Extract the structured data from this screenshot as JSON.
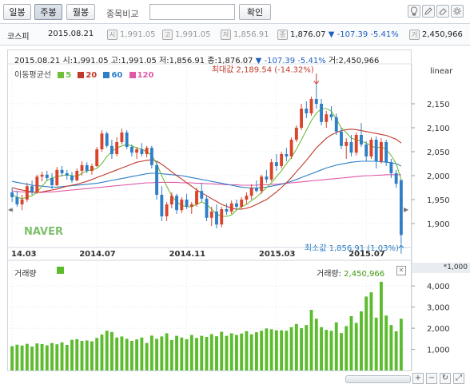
{
  "toolbar": {
    "period_buttons": [
      "일봉",
      "주봉",
      "월봉"
    ],
    "active_period": "주봉",
    "compare_label": "종목비교",
    "compare_placeholder": "",
    "confirm_label": "확인"
  },
  "summary": {
    "name": "코스피",
    "date": "2015.08.21",
    "open_badge": "시",
    "open": "1,991.05",
    "high_badge": "고",
    "high": "1,991.05",
    "low_badge": "저",
    "low": "1,856.91",
    "close_badge": "종",
    "close": "1,876.07",
    "change": "-107.39",
    "change_pct": "-5.41%",
    "volume_badge": "거",
    "volume": "2,450,966"
  },
  "info": {
    "date": "2015.08.21",
    "open_label": "시:",
    "open": "1,991.05",
    "high_label": "고:",
    "high": "1,991.05",
    "low_label": "저:",
    "low": "1,856.91",
    "close_label": "종:",
    "close": "1,876.07",
    "change": "-107.39",
    "change_pct": "-5.41%",
    "volume_label": "거:",
    "volume": "2,450,966"
  },
  "moving_avg": {
    "label": "이동평균선",
    "items": [
      {
        "period": "5",
        "color": "#6fbf3a"
      },
      {
        "period": "20",
        "color": "#c0392b"
      },
      {
        "period": "60",
        "color": "#2f7fc8"
      },
      {
        "period": "120",
        "color": "#e05aa8"
      }
    ]
  },
  "scale_label": "linear",
  "watermark": "NAVER",
  "volume_panel": {
    "label": "거래량",
    "value_label": "거래량:",
    "value": "2,450,966",
    "unit_label": "*1,000",
    "bar_color": "#5dbb2e"
  },
  "colors": {
    "up": "#d9442b",
    "down": "#2f7fc8",
    "ma5": "#6fbf3a",
    "ma20": "#c0392b",
    "ma60": "#2f7fc8",
    "ma120": "#e05aa8"
  },
  "chart_data": {
    "type": "candlestick",
    "price_axis": {
      "ticks": [
        1900,
        1950,
        2000,
        2050,
        2100,
        2150
      ],
      "tick_labels": [
        "1,900",
        "1,950",
        "2,000",
        "2,050",
        "2,100",
        "2,150"
      ],
      "ylim": [
        1850,
        2200
      ]
    },
    "volume_axis": {
      "ticks": [
        1000,
        2000,
        3000,
        4000
      ],
      "tick_labels": [
        "1,000",
        "2,000",
        "3,000",
        "4,000"
      ],
      "ylim": [
        0,
        4500
      ]
    },
    "x_labels": [
      {
        "index": 0,
        "label": "14.03"
      },
      {
        "index": 17,
        "label": "2014.07"
      },
      {
        "index": 35,
        "label": "2014.11"
      },
      {
        "index": 53,
        "label": "2015.03"
      },
      {
        "index": 71,
        "label": "2015.07"
      }
    ],
    "max_annotation": {
      "index": 61,
      "value": 2189.54,
      "text": "최대값 2,189.54 (-14.32%)"
    },
    "min_annotation": {
      "index": 78,
      "value": 1856.91,
      "text": "최소값 1,856.91 (1.03%)"
    },
    "candles": [
      {
        "o": 1965,
        "h": 1975,
        "l": 1945,
        "c": 1955
      },
      {
        "o": 1955,
        "h": 1968,
        "l": 1935,
        "c": 1940
      },
      {
        "o": 1940,
        "h": 1960,
        "l": 1928,
        "c": 1950
      },
      {
        "o": 1950,
        "h": 1985,
        "l": 1945,
        "c": 1978
      },
      {
        "o": 1978,
        "h": 1990,
        "l": 1960,
        "c": 1965
      },
      {
        "o": 1965,
        "h": 2002,
        "l": 1962,
        "c": 1998
      },
      {
        "o": 1998,
        "h": 2008,
        "l": 1988,
        "c": 2002
      },
      {
        "o": 2002,
        "h": 2010,
        "l": 1990,
        "c": 1995
      },
      {
        "o": 1995,
        "h": 2005,
        "l": 1972,
        "c": 1980
      },
      {
        "o": 1980,
        "h": 2018,
        "l": 1978,
        "c": 2012
      },
      {
        "o": 2012,
        "h": 2020,
        "l": 1998,
        "c": 2005
      },
      {
        "o": 2005,
        "h": 2012,
        "l": 1992,
        "c": 2000
      },
      {
        "o": 2000,
        "h": 2008,
        "l": 1985,
        "c": 1990
      },
      {
        "o": 1990,
        "h": 2015,
        "l": 1988,
        "c": 2010
      },
      {
        "o": 2010,
        "h": 2030,
        "l": 2000,
        "c": 2022
      },
      {
        "o": 2022,
        "h": 2028,
        "l": 2005,
        "c": 2010
      },
      {
        "o": 2010,
        "h": 2025,
        "l": 2002,
        "c": 2020
      },
      {
        "o": 2020,
        "h": 2060,
        "l": 2018,
        "c": 2055
      },
      {
        "o": 2055,
        "h": 2095,
        "l": 2050,
        "c": 2088
      },
      {
        "o": 2088,
        "h": 2092,
        "l": 2058,
        "c": 2062
      },
      {
        "o": 2062,
        "h": 2075,
        "l": 2035,
        "c": 2045
      },
      {
        "o": 2045,
        "h": 2080,
        "l": 2040,
        "c": 2070
      },
      {
        "o": 2070,
        "h": 2098,
        "l": 2065,
        "c": 2090
      },
      {
        "o": 2090,
        "h": 2095,
        "l": 2055,
        "c": 2060
      },
      {
        "o": 2060,
        "h": 2065,
        "l": 2040,
        "c": 2048
      },
      {
        "o": 2048,
        "h": 2060,
        "l": 2035,
        "c": 2055
      },
      {
        "o": 2055,
        "h": 2068,
        "l": 2040,
        "c": 2045
      },
      {
        "o": 2045,
        "h": 2062,
        "l": 2038,
        "c": 2058
      },
      {
        "o": 2058,
        "h": 2062,
        "l": 2015,
        "c": 2022
      },
      {
        "o": 2022,
        "h": 2030,
        "l": 1950,
        "c": 1960
      },
      {
        "o": 1960,
        "h": 1978,
        "l": 1905,
        "c": 1915
      },
      {
        "o": 1915,
        "h": 1945,
        "l": 1905,
        "c": 1940
      },
      {
        "o": 1940,
        "h": 1965,
        "l": 1932,
        "c": 1958
      },
      {
        "o": 1958,
        "h": 1962,
        "l": 1920,
        "c": 1928
      },
      {
        "o": 1928,
        "h": 1955,
        "l": 1922,
        "c": 1950
      },
      {
        "o": 1950,
        "h": 1962,
        "l": 1930,
        "c": 1935
      },
      {
        "o": 1935,
        "h": 1945,
        "l": 1920,
        "c": 1940
      },
      {
        "o": 1940,
        "h": 1975,
        "l": 1935,
        "c": 1968
      },
      {
        "o": 1968,
        "h": 1985,
        "l": 1945,
        "c": 1952
      },
      {
        "o": 1952,
        "h": 1958,
        "l": 1905,
        "c": 1912
      },
      {
        "o": 1912,
        "h": 1935,
        "l": 1895,
        "c": 1925
      },
      {
        "o": 1925,
        "h": 1940,
        "l": 1890,
        "c": 1898
      },
      {
        "o": 1898,
        "h": 1935,
        "l": 1892,
        "c": 1930
      },
      {
        "o": 1930,
        "h": 1942,
        "l": 1918,
        "c": 1925
      },
      {
        "o": 1925,
        "h": 1948,
        "l": 1920,
        "c": 1942
      },
      {
        "o": 1942,
        "h": 1950,
        "l": 1928,
        "c": 1935
      },
      {
        "o": 1935,
        "h": 1955,
        "l": 1930,
        "c": 1950
      },
      {
        "o": 1950,
        "h": 1965,
        "l": 1940,
        "c": 1958
      },
      {
        "o": 1958,
        "h": 1982,
        "l": 1950,
        "c": 1975
      },
      {
        "o": 1975,
        "h": 1990,
        "l": 1965,
        "c": 1968
      },
      {
        "o": 1968,
        "h": 2002,
        "l": 1962,
        "c": 1998
      },
      {
        "o": 1998,
        "h": 2012,
        "l": 1985,
        "c": 1992
      },
      {
        "o": 1992,
        "h": 2035,
        "l": 1988,
        "c": 2028
      },
      {
        "o": 2028,
        "h": 2045,
        "l": 2010,
        "c": 2020
      },
      {
        "o": 2020,
        "h": 2050,
        "l": 2015,
        "c": 2045
      },
      {
        "o": 2045,
        "h": 2058,
        "l": 2030,
        "c": 2040
      },
      {
        "o": 2040,
        "h": 2080,
        "l": 2035,
        "c": 2075
      },
      {
        "o": 2075,
        "h": 2105,
        "l": 2070,
        "c": 2100
      },
      {
        "o": 2100,
        "h": 2150,
        "l": 2095,
        "c": 2140
      },
      {
        "o": 2140,
        "h": 2155,
        "l": 2120,
        "c": 2130
      },
      {
        "o": 2130,
        "h": 2165,
        "l": 2125,
        "c": 2160
      },
      {
        "o": 2160,
        "h": 2189.54,
        "l": 2140,
        "c": 2150
      },
      {
        "o": 2150,
        "h": 2160,
        "l": 2105,
        "c": 2112
      },
      {
        "o": 2112,
        "h": 2135,
        "l": 2100,
        "c": 2128
      },
      {
        "o": 2128,
        "h": 2145,
        "l": 2115,
        "c": 2122
      },
      {
        "o": 2122,
        "h": 2130,
        "l": 2085,
        "c": 2092
      },
      {
        "o": 2092,
        "h": 2100,
        "l": 2055,
        "c": 2062
      },
      {
        "o": 2062,
        "h": 2078,
        "l": 2035,
        "c": 2070
      },
      {
        "o": 2070,
        "h": 2085,
        "l": 2040,
        "c": 2048
      },
      {
        "o": 2048,
        "h": 2090,
        "l": 2042,
        "c": 2085
      },
      {
        "o": 2085,
        "h": 2110,
        "l": 2060,
        "c": 2065
      },
      {
        "o": 2065,
        "h": 2072,
        "l": 2030,
        "c": 2040
      },
      {
        "o": 2040,
        "h": 2080,
        "l": 2035,
        "c": 2075
      },
      {
        "o": 2075,
        "h": 2082,
        "l": 2015,
        "c": 2030
      },
      {
        "o": 2030,
        "h": 2078,
        "l": 2025,
        "c": 2070
      },
      {
        "o": 2070,
        "h": 2075,
        "l": 2020,
        "c": 2028
      },
      {
        "o": 2028,
        "h": 2035,
        "l": 1995,
        "c": 2005
      },
      {
        "o": 2005,
        "h": 2012,
        "l": 1975,
        "c": 1983
      },
      {
        "o": 1991.05,
        "h": 1991.05,
        "l": 1856.91,
        "c": 1876.07
      }
    ],
    "ma5": [
      1960,
      1955,
      1952,
      1955,
      1958,
      1965,
      1978,
      1990,
      1995,
      1998,
      2000,
      2002,
      2000,
      1998,
      2005,
      2010,
      2012,
      2015,
      2025,
      2040,
      2050,
      2058,
      2062,
      2065,
      2062,
      2058,
      2055,
      2050,
      2042,
      2025,
      2000,
      1978,
      1958,
      1945,
      1938,
      1935,
      1935,
      1940,
      1945,
      1940,
      1930,
      1920,
      1915,
      1915,
      1918,
      1928,
      1935,
      1940,
      1948,
      1955,
      1965,
      1975,
      1985,
      1998,
      2010,
      2025,
      2038,
      2055,
      2075,
      2095,
      2115,
      2130,
      2140,
      2140,
      2135,
      2118,
      2100,
      2090,
      2078,
      2075,
      2072,
      2068,
      2062,
      2058,
      2060,
      2055,
      2042,
      2025,
      1992
    ],
    "ma20": [
      1975,
      1972,
      1970,
      1968,
      1966,
      1965,
      1966,
      1968,
      1970,
      1972,
      1975,
      1978,
      1980,
      1982,
      1985,
      1988,
      1992,
      1996,
      2000,
      2004,
      2008,
      2012,
      2016,
      2020,
      2024,
      2028,
      2030,
      2032,
      2033,
      2030,
      2024,
      2016,
      2008,
      2000,
      1993,
      1985,
      1978,
      1970,
      1964,
      1958,
      1952,
      1946,
      1940,
      1936,
      1932,
      1930,
      1930,
      1932,
      1935,
      1940,
      1945,
      1950,
      1958,
      1966,
      1975,
      1985,
      1996,
      2008,
      2020,
      2032,
      2045,
      2058,
      2068,
      2078,
      2085,
      2090,
      2094,
      2096,
      2097,
      2096,
      2094,
      2092,
      2090,
      2088,
      2086,
      2084,
      2080,
      2076,
      2068
    ],
    "ma60": [
      1988,
      1986,
      1984,
      1982,
      1980,
      1979,
      1978,
      1977,
      1976,
      1976,
      1977,
      1978,
      1979,
      1980,
      1981,
      1982,
      1983,
      1984,
      1986,
      1988,
      1990,
      1992,
      1994,
      1996,
      1998,
      2000,
      2002,
      2004,
      2005,
      2005,
      2004,
      2003,
      2002,
      2001,
      2000,
      1998,
      1996,
      1994,
      1992,
      1990,
      1988,
      1986,
      1984,
      1982,
      1980,
      1978,
      1976,
      1975,
      1974,
      1974,
      1975,
      1976,
      1978,
      1980,
      1982,
      1985,
      1988,
      1992,
      1996,
      2000,
      2004,
      2008,
      2012,
      2016,
      2019,
      2022,
      2024,
      2026,
      2028,
      2029,
      2030,
      2030,
      2030,
      2030,
      2029,
      2028,
      2027,
      2025,
      2020
    ],
    "ma120": [
      1968,
      1967,
      1966,
      1966,
      1965,
      1965,
      1965,
      1966,
      1966,
      1967,
      1968,
      1969,
      1970,
      1971,
      1972,
      1973,
      1974,
      1975,
      1976,
      1977,
      1978,
      1979,
      1980,
      1981,
      1982,
      1983,
      1984,
      1985,
      1985,
      1986,
      1986,
      1986,
      1986,
      1986,
      1985,
      1985,
      1985,
      1984,
      1984,
      1983,
      1983,
      1982,
      1982,
      1981,
      1981,
      1981,
      1980,
      1980,
      1980,
      1980,
      1981,
      1981,
      1982,
      1982,
      1983,
      1984,
      1985,
      1986,
      1987,
      1988,
      1989,
      1990,
      1991,
      1992,
      1993,
      1994,
      1995,
      1996,
      1997,
      1998,
      1999,
      2000,
      2000,
      2001,
      2001,
      2002,
      2002,
      2002,
      2002
    ],
    "volume": [
      1150,
      1220,
      1180,
      1260,
      1130,
      1280,
      1250,
      1190,
      1300,
      1240,
      1330,
      1210,
      1450,
      1480,
      1400,
      1420,
      1380,
      1540,
      1700,
      1880,
      1820,
      1560,
      1610,
      1500,
      1400,
      1470,
      1560,
      1300,
      1650,
      1500,
      1610,
      1760,
      1440,
      1640,
      1560,
      1480,
      1680,
      1540,
      1640,
      1590,
      1720,
      1620,
      1830,
      1640,
      1760,
      1680,
      1750,
      1860,
      1710,
      1810,
      1880,
      1990,
      1950,
      1900,
      1900,
      1880,
      2050,
      2200,
      2000,
      2150,
      2870,
      2450,
      2050,
      1920,
      1880,
      2280,
      1770,
      2100,
      2570,
      2250,
      2800,
      3500,
      3700,
      2500,
      4200,
      2600,
      2150,
      1850,
      2451
    ]
  }
}
